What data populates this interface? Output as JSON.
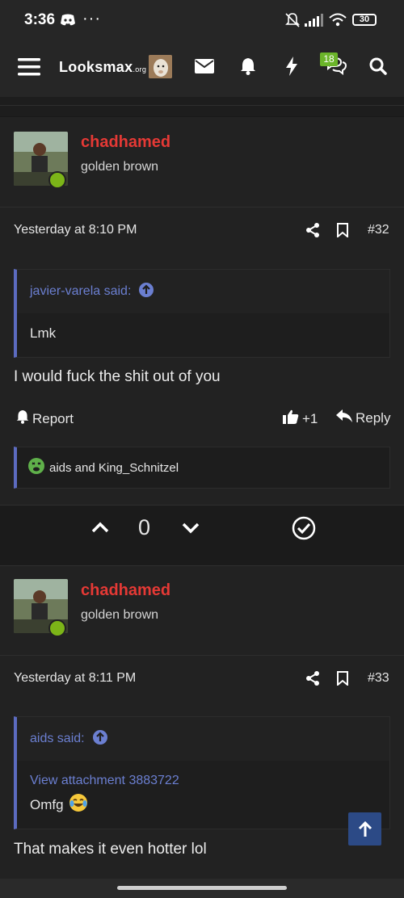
{
  "status": {
    "time": "3:36",
    "extra": "···",
    "battery": "30"
  },
  "nav": {
    "logo": "Looksmax",
    "logo_suffix": ".org",
    "badge_count": "18"
  },
  "posts": [
    {
      "username": "chadhamed",
      "user_title": "golden brown",
      "time": "Yesterday at 8:10 PM",
      "number": "#32",
      "quote_author": "javier-varela said:",
      "quote_text": "Lmk",
      "message": "I would fuck the shit out of you",
      "report_label": "Report",
      "like_label": "+1",
      "reply_label": "Reply",
      "reactions": "aids and King_Schnitzel",
      "vote_count": "0"
    },
    {
      "username": "chadhamed",
      "user_title": "golden brown",
      "time": "Yesterday at 8:11 PM",
      "number": "#33",
      "quote_author": "aids said:",
      "quote_link": "View attachment 3883722",
      "quote_text": "Omfg",
      "message": "That makes it even hotter lol"
    }
  ],
  "colors": {
    "username": "#e53935",
    "accent": "#5c6bc0",
    "online": "#7cb518"
  }
}
